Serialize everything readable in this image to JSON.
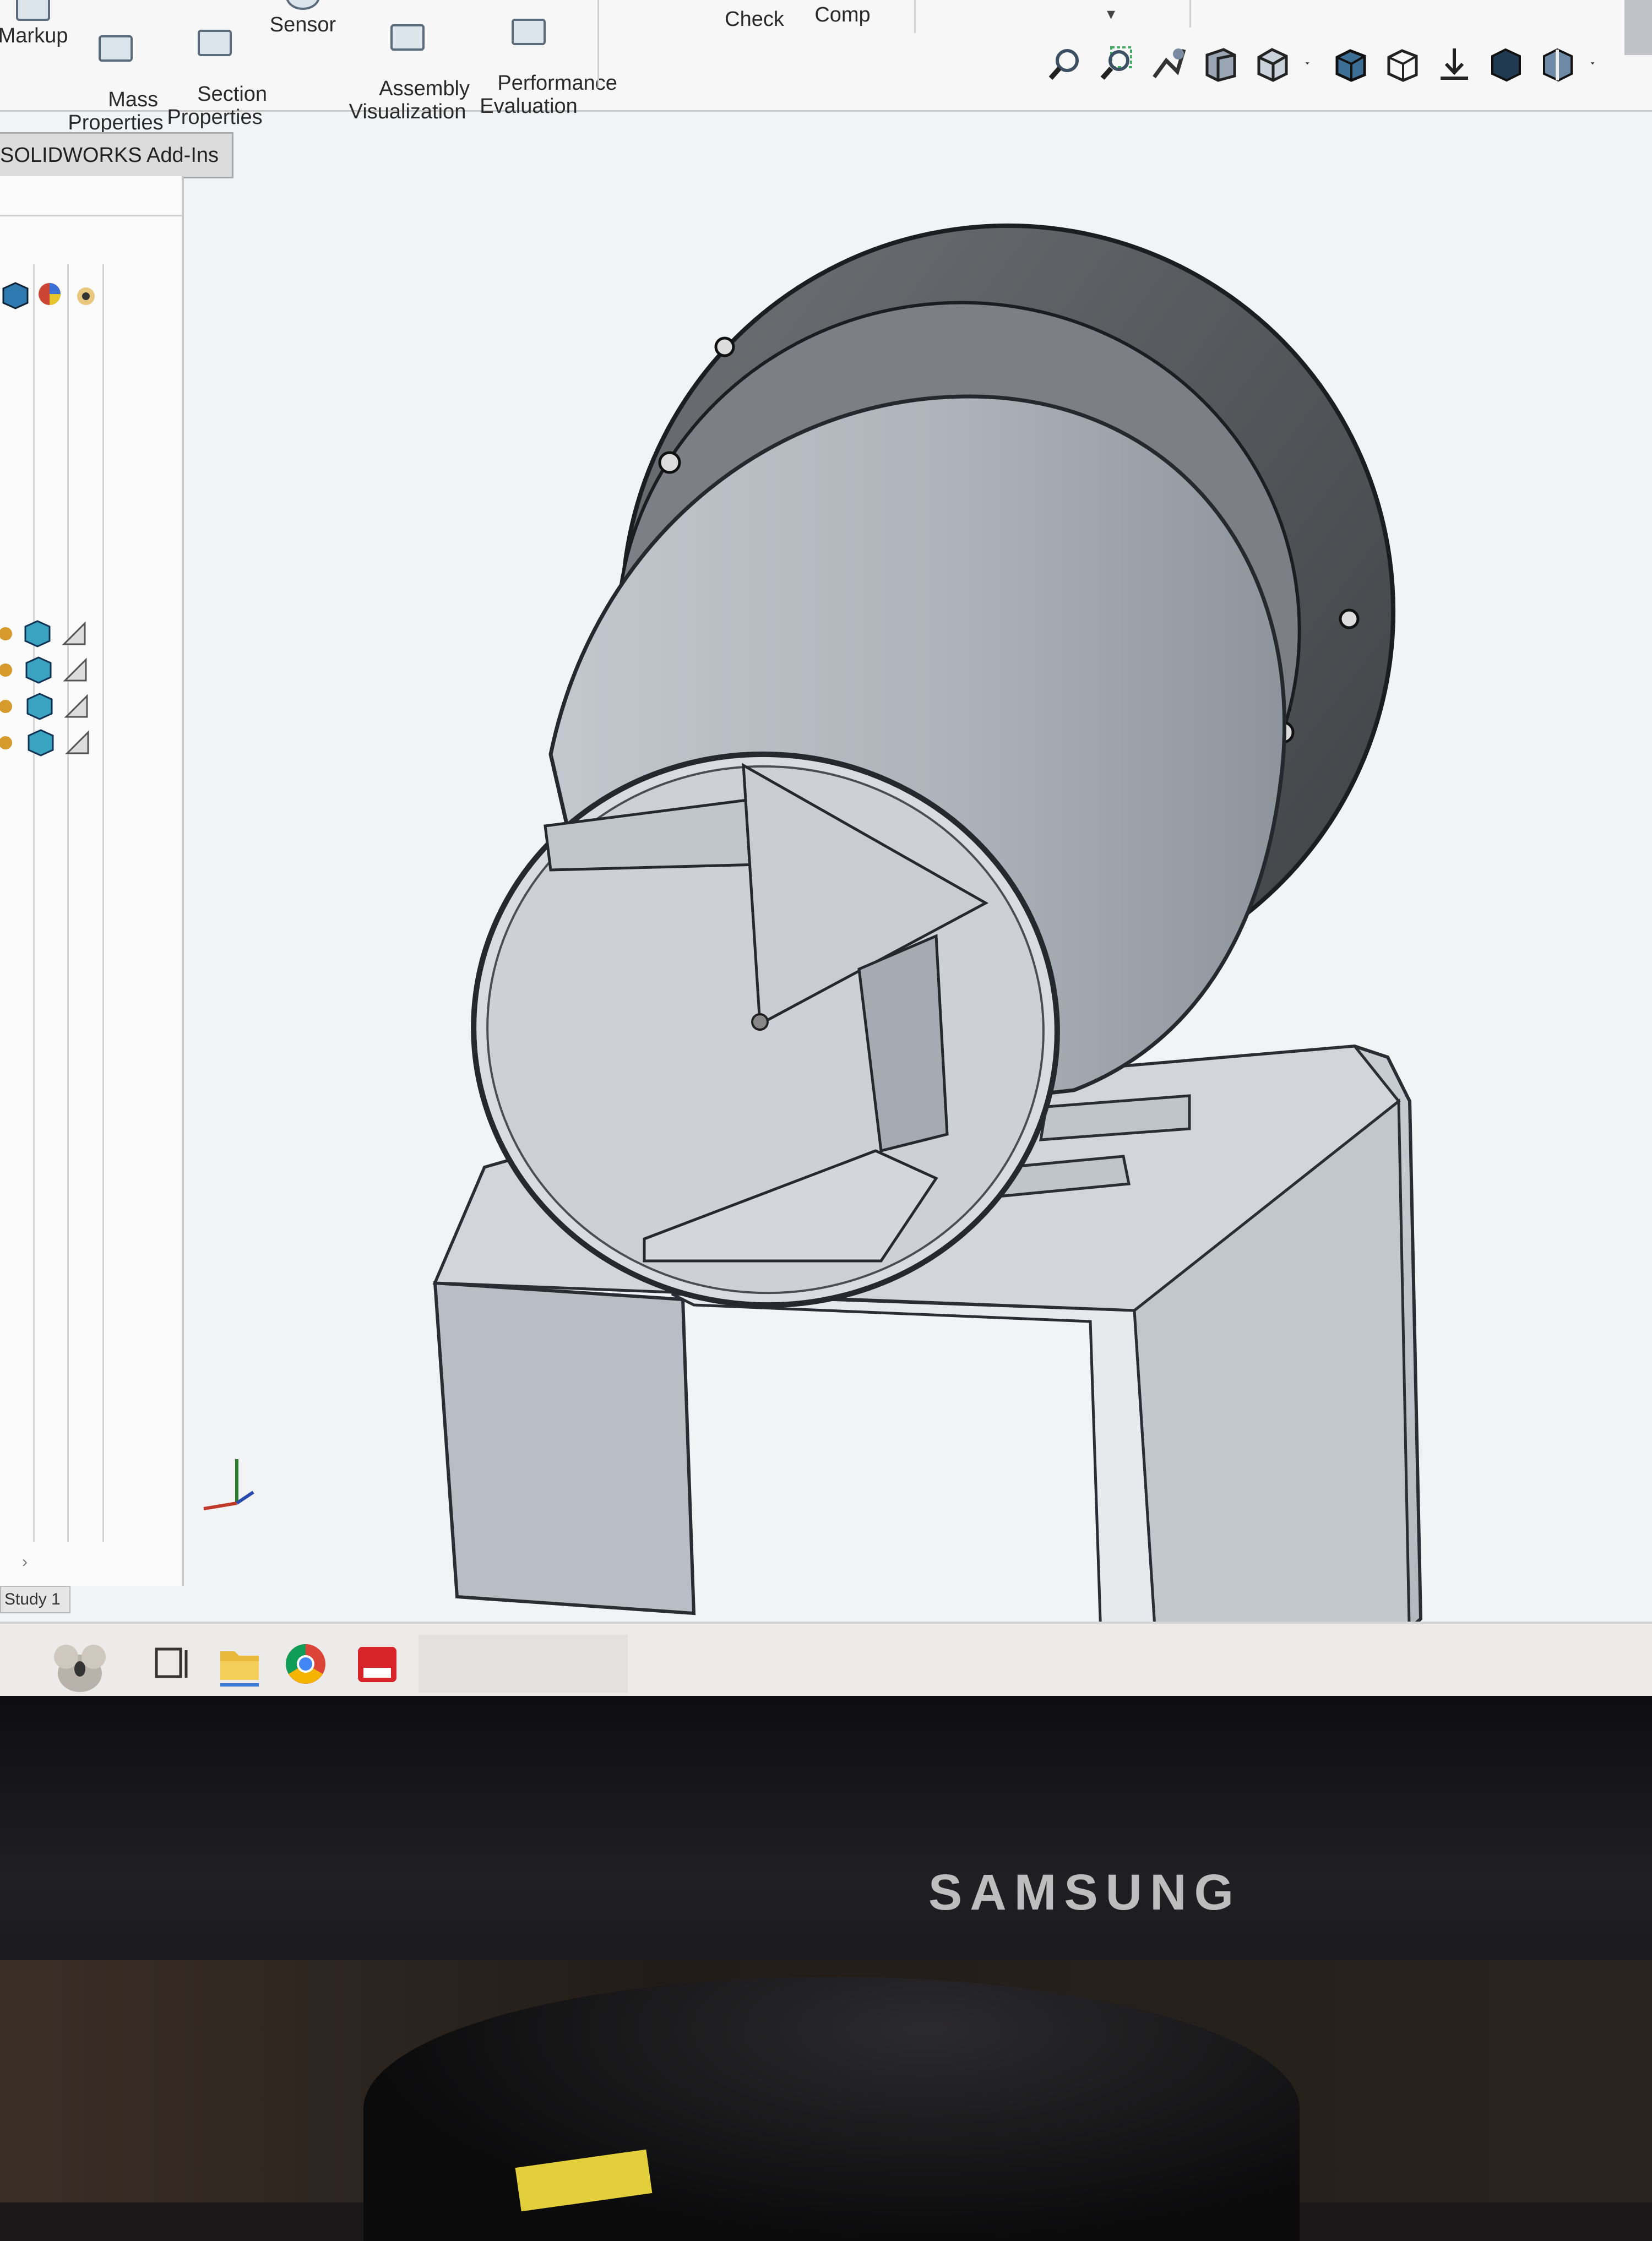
{
  "ribbon": {
    "tools": [
      {
        "label": "Markup"
      },
      {
        "label": "Mass\nProperties"
      },
      {
        "label": "Section\nProperties"
      },
      {
        "label": "Sensor"
      },
      {
        "label": "Assembly\nVisualization"
      },
      {
        "label": "Performance\nEvaluation"
      },
      {
        "label": "Check"
      },
      {
        "label": "Comp"
      }
    ],
    "view_icons": [
      "zoom-to-fit-icon",
      "zoom-to-area-icon",
      "previous-view-icon",
      "section-view-icon",
      "view-orientation-icon",
      "display-style-icon",
      "hide-show-icon",
      "edit-appearance-icon",
      "apply-scene-icon",
      "view-settings-icon"
    ]
  },
  "tabs": {
    "addins": "SOLIDWORKS Add-Ins",
    "study": "Study 1"
  },
  "panel": {
    "tree_rows": 4
  },
  "taskbar": {
    "apps": [
      "koala-icon",
      "task-view-icon",
      "file-explorer-icon",
      "chrome-icon",
      "solidworks-icon"
    ]
  },
  "monitor": {
    "brand": "SAMSUNG"
  },
  "colors": {
    "screen_bg": "#f2f3f4",
    "model_shell": "#b9bec6",
    "model_dark": "#5a5c61",
    "bezel": "#111113"
  }
}
